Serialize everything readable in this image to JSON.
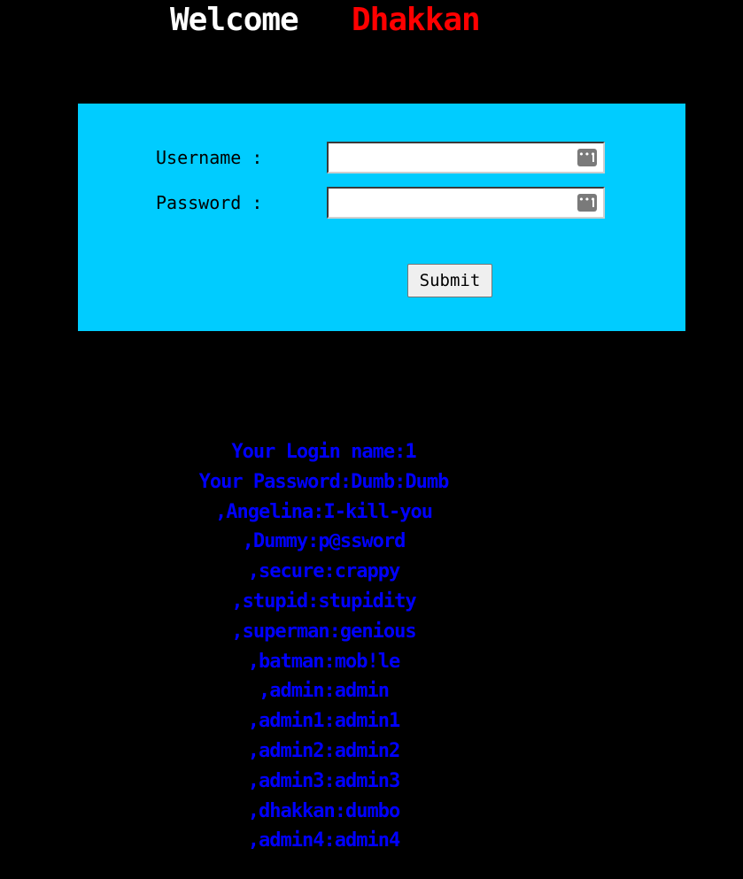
{
  "header": {
    "welcome": "Welcome",
    "name": "Dhakkan"
  },
  "form": {
    "username_label": "Username :",
    "password_label": "Password :",
    "username_value": "",
    "password_value": "",
    "submit_label": "Submit",
    "password_manager_icon": "password-manager-key-icon"
  },
  "output": {
    "lines": [
      "Your Login name:1",
      "Your Password:Dumb:Dumb",
      ",Angelina:I-kill-you",
      ",Dummy:p@ssword",
      ",secure:crappy",
      ",stupid:stupidity",
      ",superman:genious",
      ",batman:mob!le",
      ",admin:admin",
      ",admin1:admin1",
      ",admin2:admin2",
      ",admin3:admin3",
      ",dhakkan:dumbo",
      ",admin4:admin4"
    ]
  },
  "colors": {
    "background": "#000000",
    "welcome_text": "#ffffff",
    "name_text": "#ff0000",
    "panel": "#00ccff",
    "output_text": "#0000ff"
  }
}
